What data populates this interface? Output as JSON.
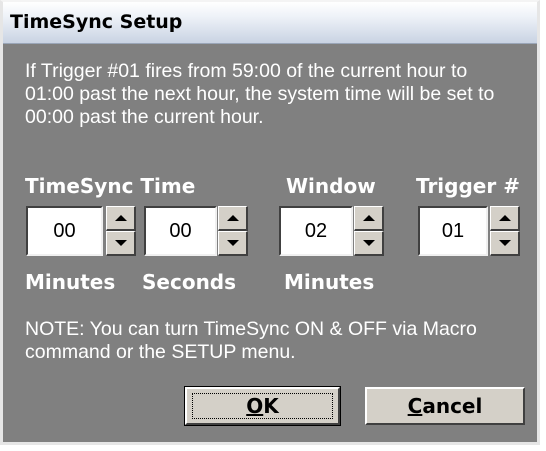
{
  "window": {
    "title": "TimeSync Setup"
  },
  "description": "If Trigger #01 fires from 59:00 of the current hour to 01:00 past the next hour, the system time will be set to 00:00 past the current hour.",
  "labels": {
    "timesync_time": "TimeSync Time",
    "window": "Window",
    "trigger": "Trigger #",
    "minutes_1": "Minutes",
    "seconds": "Seconds",
    "minutes_2": "Minutes"
  },
  "fields": {
    "timesync_minutes": "00",
    "timesync_seconds": "00",
    "window_minutes": "02",
    "trigger_number": "01"
  },
  "note": "NOTE: You can turn TimeSync ON & OFF via Macro command or the SETUP menu.",
  "buttons": {
    "ok": {
      "mnemonic": "O",
      "rest": "K"
    },
    "cancel": {
      "mnemonic": "C",
      "rest": "ancel"
    }
  },
  "colors": {
    "dialog_background": "#808080",
    "text": "#ffffff",
    "button_face": "#d4d0c8"
  }
}
